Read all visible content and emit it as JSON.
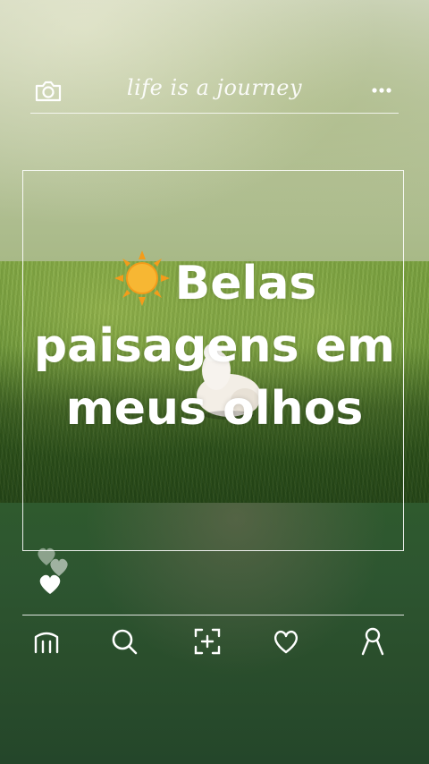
{
  "header": {
    "title": "life is a journey",
    "camera_icon": "camera-icon",
    "more_icon": "more-options-icon"
  },
  "caption": {
    "emoji": "sun-icon",
    "lines": [
      "Belas",
      "paisagens em",
      "meus olhos"
    ]
  },
  "hearts": {
    "icon": "heart-icon",
    "count": 3
  },
  "nav": {
    "items": [
      {
        "name": "home",
        "icon": "home-icon"
      },
      {
        "name": "search",
        "icon": "search-icon"
      },
      {
        "name": "add",
        "icon": "add-post-icon"
      },
      {
        "name": "likes",
        "icon": "heart-icon"
      },
      {
        "name": "profile",
        "icon": "profile-icon"
      }
    ]
  },
  "colors": {
    "text": "#ffffff",
    "sun": "#f5a623",
    "grass": "#4f7f2a"
  }
}
